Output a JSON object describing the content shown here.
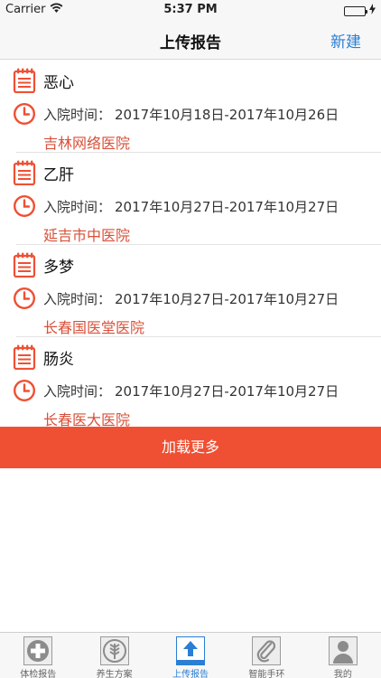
{
  "status_bar": {
    "carrier": "Carrier",
    "time": "5:37 PM"
  },
  "nav": {
    "title": "上传报告",
    "action_label": "新建"
  },
  "reports": [
    {
      "title": "恶心",
      "time_label": "入院时间：",
      "time_range": "2017年10月18日-2017年10月26日",
      "hospital": "吉林网络医院"
    },
    {
      "title": "乙肝",
      "time_label": "入院时间：",
      "time_range": "2017年10月27日-2017年10月27日",
      "hospital": "延吉市中医院"
    },
    {
      "title": "多梦",
      "time_label": "入院时间：",
      "time_range": "2017年10月27日-2017年10月27日",
      "hospital": "长春国医堂医院"
    },
    {
      "title": "肠炎",
      "time_label": "入院时间：",
      "time_range": "2017年10月27日-2017年10月27日",
      "hospital": "长春医大医院"
    }
  ],
  "load_more_label": "加载更多",
  "tabs": [
    {
      "label": "体检报告",
      "icon": "medical-kit-icon"
    },
    {
      "label": "养生方案",
      "icon": "wheat-icon"
    },
    {
      "label": "上传报告",
      "icon": "upload-icon",
      "active": true
    },
    {
      "label": "智能手环",
      "icon": "paperclip-icon"
    },
    {
      "label": "我的",
      "icon": "person-icon"
    }
  ],
  "colors": {
    "accent": "#ef5033",
    "hospital_text": "#d9503a",
    "nav_action": "#2a7fd4",
    "active_tab": "#2a7fd4"
  }
}
